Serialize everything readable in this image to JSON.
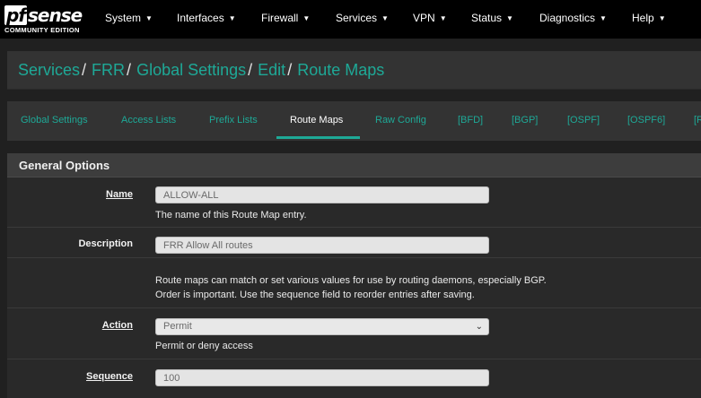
{
  "brand": {
    "logo_pf": "pf",
    "logo_text": "sense",
    "edition": "COMMUNITY EDITION"
  },
  "nav": {
    "items": [
      {
        "label": "System"
      },
      {
        "label": "Interfaces"
      },
      {
        "label": "Firewall"
      },
      {
        "label": "Services"
      },
      {
        "label": "VPN"
      },
      {
        "label": "Status"
      },
      {
        "label": "Diagnostics"
      },
      {
        "label": "Help"
      }
    ]
  },
  "breadcrumb": {
    "items": [
      "Services",
      "FRR",
      "Global Settings",
      "Edit",
      "Route Maps"
    ],
    "separator": "/"
  },
  "tabs": {
    "items": [
      {
        "label": "Global Settings"
      },
      {
        "label": "Access Lists"
      },
      {
        "label": "Prefix Lists"
      },
      {
        "label": "Route Maps"
      },
      {
        "label": "Raw Config"
      },
      {
        "label": "[BFD]"
      },
      {
        "label": "[BGP]"
      },
      {
        "label": "[OSPF]"
      },
      {
        "label": "[OSPF6]"
      },
      {
        "label": "[R"
      }
    ],
    "active": "Route Maps"
  },
  "panel": {
    "title": "General Options",
    "name": {
      "label": "Name",
      "value": "ALLOW-ALL",
      "help": "The name of this Route Map entry."
    },
    "description": {
      "label": "Description",
      "value": "FRR Allow All routes"
    },
    "info": {
      "line1": "Route maps can match or set various values for use by routing daemons, especially BGP.",
      "line2": "Order is important. Use the sequence field to reorder entries after saving."
    },
    "action": {
      "label": "Action",
      "selected": "Permit",
      "help": "Permit or deny access"
    },
    "sequence": {
      "label": "Sequence",
      "value": "100"
    }
  },
  "colors": {
    "accent": "#1ea997",
    "navbar": "#000000",
    "background": "#202020",
    "panel": "#292929"
  }
}
